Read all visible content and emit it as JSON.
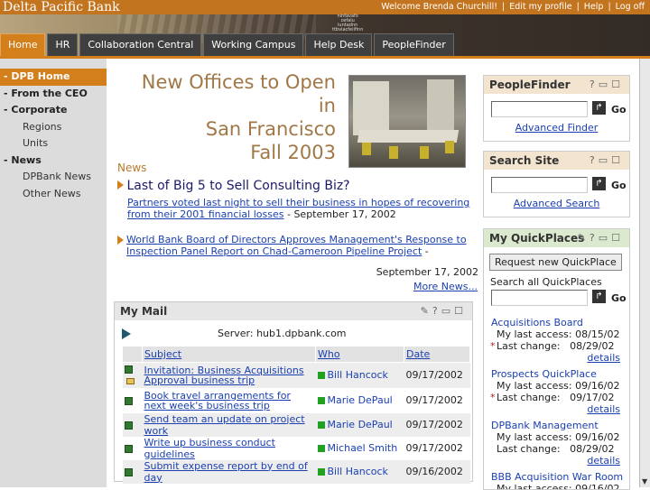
{
  "header": {
    "bank_name": "Delta Pacific Bank",
    "welcome": "Welcome Brenda Churchill!",
    "links": [
      "Edit my profile",
      "Help",
      "Log off"
    ],
    "ticker_lines": [
      "ninfavafo",
      "cefalu",
      "iuntadnn",
      "ttbviacfeiifinn"
    ]
  },
  "tabs": [
    {
      "label": "Home",
      "active": true
    },
    {
      "label": "HR"
    },
    {
      "label": "Collaboration Central"
    },
    {
      "label": "Working Campus"
    },
    {
      "label": "Help Desk"
    },
    {
      "label": "PeopleFinder"
    }
  ],
  "sidebar": {
    "items": [
      {
        "label": "- DPB Home",
        "level": 0
      },
      {
        "label": "- From the CEO",
        "level": 0
      },
      {
        "label": "- Corporate",
        "level": 0
      },
      {
        "label": "Regions",
        "level": 1
      },
      {
        "label": "Units",
        "level": 1
      },
      {
        "label": "- News",
        "level": 0
      },
      {
        "label": "DPBank News",
        "level": 1
      },
      {
        "label": "Other News",
        "level": 1
      }
    ]
  },
  "hero": {
    "line1": "New Offices to Open in",
    "line2": "San Francisco",
    "line3": "Fall 2003"
  },
  "news": {
    "heading": "News",
    "story1": {
      "title": "Last of Big 5 to Sell Consulting Biz?",
      "link": "Partners voted last night to sell their business in hopes of recovering from their 2001 financial losses",
      "date": " - September 17, 2002"
    },
    "story2": {
      "link": "World Bank Board of Directors Approves Management's Response to Inspection Panel Report on Chad-Cameroon Pipeline Project",
      "dash": " -",
      "date": "September 17, 2002"
    },
    "more": "More News..."
  },
  "mymail": {
    "title": "My Mail",
    "server": "Server: hub1.dpbank.com",
    "columns": [
      "Subject",
      "Who",
      "Date"
    ],
    "rows": [
      {
        "subject": "Invitation: Business Acquisitions Approval business trip",
        "who": "Bill Hancock",
        "date": "09/17/2002"
      },
      {
        "subject": "Book travel arrangements for next week's business trip",
        "who": "Marie DePaul",
        "date": "09/17/2002"
      },
      {
        "subject": "Send team an update on project work",
        "who": "Marie DePaul",
        "date": "09/17/2002"
      },
      {
        "subject": "Write up business conduct guidelines",
        "who": "Michael Smith",
        "date": "09/17/2002"
      },
      {
        "subject": "Submit expense report by end of day",
        "who": "Bill Hancock",
        "date": "09/16/2002"
      }
    ]
  },
  "peoplefinder": {
    "title": "PeopleFinder",
    "go": "Go",
    "link": "Advanced Finder"
  },
  "searchsite": {
    "title": "Search Site",
    "go": "Go",
    "link": "Advanced Search"
  },
  "quickplaces": {
    "title": "My QuickPlaces",
    "button": "Request new QuickPlace",
    "search_label": "Search all QuickPlaces",
    "go": "Go",
    "last_access_label": "My last access:",
    "last_change_label": "Last change:",
    "details": "details",
    "places": [
      {
        "name": "Acquisitions Board",
        "access": "08/15/02",
        "change": "08/29/02",
        "star": true
      },
      {
        "name": "Prospects QuickPlace",
        "access": "09/16/02",
        "change": "09/17/02",
        "star": true
      },
      {
        "name": "DPBank Management",
        "access": "09/16/02",
        "change": "08/29/02",
        "star": false
      },
      {
        "name": "BBB Acquisition War Room",
        "access": "09/16/02",
        "change": "",
        "star": false
      }
    ]
  },
  "colors": {
    "accent": "#d27f1c",
    "link": "#1a3fb0",
    "sidebar": "#dcdcdc"
  }
}
